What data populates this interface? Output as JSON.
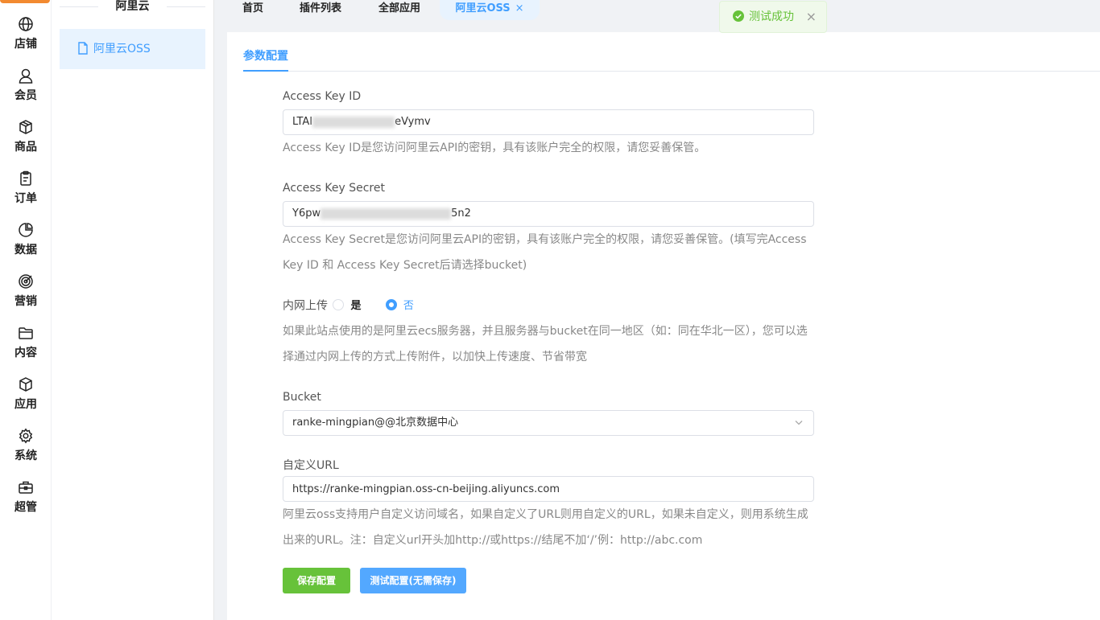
{
  "rail": {
    "items": [
      {
        "label": "店铺",
        "icon": "globe-icon"
      },
      {
        "label": "会员",
        "icon": "user-icon"
      },
      {
        "label": "商品",
        "icon": "box-icon"
      },
      {
        "label": "订单",
        "icon": "clipboard-icon"
      },
      {
        "label": "数据",
        "icon": "pie-chart-icon"
      },
      {
        "label": "营销",
        "icon": "target-icon"
      },
      {
        "label": "内容",
        "icon": "folder-icon"
      },
      {
        "label": "应用",
        "icon": "cube-icon"
      },
      {
        "label": "系统",
        "icon": "gear-icon"
      },
      {
        "label": "超管",
        "icon": "toolbox-icon"
      }
    ]
  },
  "submenu": {
    "title": "阿里云",
    "item": "阿里云OSS"
  },
  "tabs": {
    "items": [
      "首页",
      "插件列表",
      "全部应用",
      "阿里云OSS"
    ],
    "active_close": "×"
  },
  "toast": {
    "message": "测试成功",
    "close": "×"
  },
  "form": {
    "tab": "参数配置",
    "access_key_id": {
      "label": "Access Key ID",
      "value_start": "LTAI",
      "value_end": "eVymv",
      "help": "Access Key ID是您访问阿里云API的密钥，具有该账户完全的权限，请您妥善保管。"
    },
    "access_key_secret": {
      "label": "Access Key Secret",
      "value_start": "Y6pw",
      "value_end": "5n2",
      "help_line1": "Access Key Secret是您访问阿里云API的密钥，具有该账户完全的权限，请您妥善保管。(填写完Access",
      "help_line2": "Key ID 和 Access Key Secret后请选择bucket)"
    },
    "intranet": {
      "label": "内网上传",
      "option_yes": "是",
      "option_no": "否",
      "selected": "否",
      "help_line1": "如果此站点使用的是阿里云ecs服务器，并且服务器与bucket在同一地区（如：同在华北一区），您可以选",
      "help_line2": "择通过内网上传的方式上传附件，以加快上传速度、节省带宽"
    },
    "bucket": {
      "label": "Bucket",
      "value": "ranke-mingpian@@北京数据中心"
    },
    "custom_url": {
      "label": "自定义URL",
      "value": "https://ranke-mingpian.oss-cn-beijing.aliyuncs.com",
      "help_line1": "阿里云oss支持用户自定义访问域名，如果自定义了URL则用自定义的URL，如果未自定义，则用系统生成",
      "help_line2": "出来的URL。注：自定义url开头加http://或https://结尾不加‘/’例：http://abc.com"
    },
    "save_button": "保存配置",
    "test_button": "测试配置(无需保存)"
  }
}
